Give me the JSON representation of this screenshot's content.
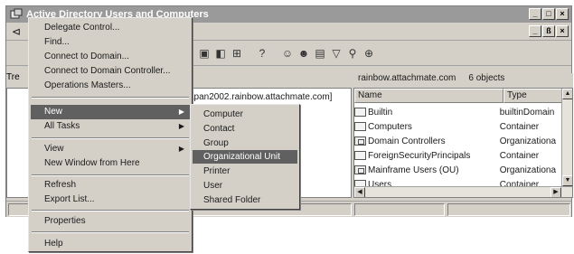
{
  "window": {
    "title": "Active Directory Users and Computers",
    "controls": [
      "_",
      "□",
      "×"
    ],
    "inner_controls": [
      "_",
      "ß",
      "×"
    ]
  },
  "tree": {
    "label": "Tre",
    "domain_text": "apan2002.rainbow.attachmate.com]"
  },
  "list": {
    "header_domain": "rainbow.attachmate.com",
    "header_count": "6 objects",
    "columns": [
      "Name",
      "Type"
    ],
    "rows": [
      {
        "name": "Builtin",
        "type": "builtinDomain",
        "icon": "folder-icon"
      },
      {
        "name": "Computers",
        "type": "Container",
        "icon": "folder-icon"
      },
      {
        "name": "Domain Controllers",
        "type": "Organizationa",
        "icon": "ou-icon"
      },
      {
        "name": "ForeignSecurityPrincipals",
        "type": "Container",
        "icon": "folder-icon"
      },
      {
        "name": "Mainframe Users (OU)",
        "type": "Organizationa",
        "icon": "ou-icon"
      },
      {
        "name": "Users",
        "type": "Container",
        "icon": "folder-icon"
      }
    ]
  },
  "context_menu": {
    "items": [
      {
        "label": "Delegate Control...",
        "name": "delegate-control"
      },
      {
        "label": "Find...",
        "name": "find"
      },
      {
        "label": "Connect to Domain...",
        "name": "connect-domain"
      },
      {
        "label": "Connect to Domain Controller...",
        "name": "connect-dc"
      },
      {
        "label": "Operations Masters...",
        "name": "operations-masters"
      },
      {
        "label": "New",
        "name": "new",
        "submenu": true,
        "highlight": true
      },
      {
        "label": "All Tasks",
        "name": "all-tasks",
        "submenu": true
      },
      {
        "label": "View",
        "name": "view",
        "submenu": true
      },
      {
        "label": "New Window from Here",
        "name": "new-window"
      },
      {
        "label": "Refresh",
        "name": "refresh"
      },
      {
        "label": "Export List...",
        "name": "export-list"
      },
      {
        "label": "Properties",
        "name": "properties"
      },
      {
        "label": "Help",
        "name": "help"
      }
    ]
  },
  "submenu": {
    "items": [
      {
        "label": "Computer"
      },
      {
        "label": "Contact"
      },
      {
        "label": "Group"
      },
      {
        "label": "Organizational Unit",
        "highlight": true
      },
      {
        "label": "Printer"
      },
      {
        "label": "User"
      },
      {
        "label": "Shared Folder"
      }
    ]
  },
  "colors": {
    "highlight": "#606060",
    "chrome": "#d4d0c8",
    "titlebar": "#9a9a9a"
  }
}
